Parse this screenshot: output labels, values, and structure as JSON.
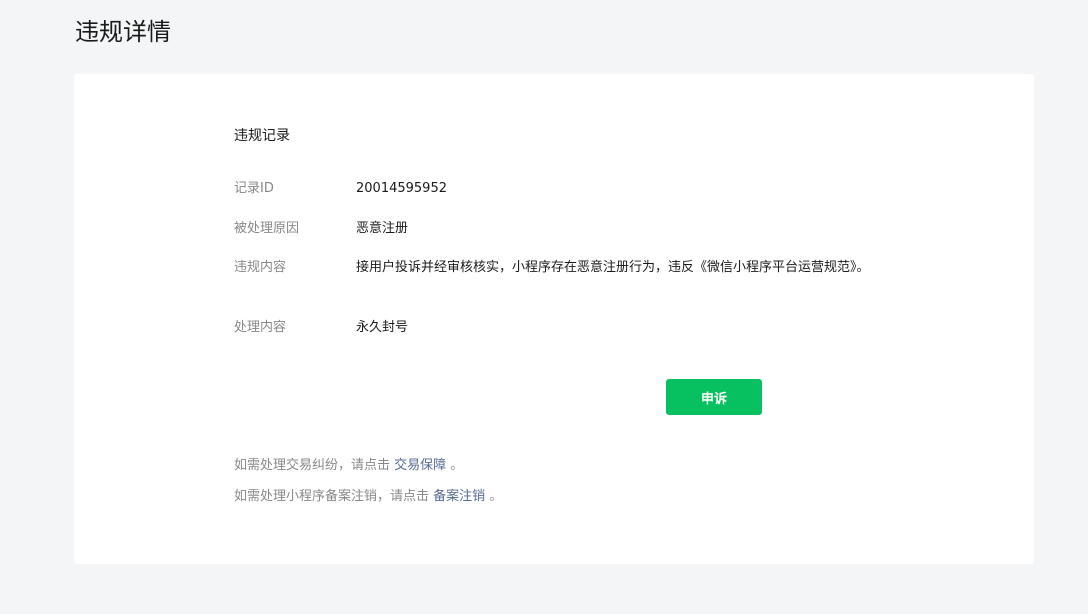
{
  "header": {
    "title": "违规详情"
  },
  "record": {
    "section_title": "违规记录",
    "rows": [
      {
        "label": "记录ID",
        "value": "20014595952"
      },
      {
        "label": "被处理原因",
        "value": "恶意注册"
      },
      {
        "label": "违规内容",
        "value": "接用户投诉并经审核核实，小程序存在恶意注册行为，违反《微信小程序平台运营规范》。"
      },
      {
        "label": "处理内容",
        "value": "永久封号"
      }
    ]
  },
  "actions": {
    "appeal_label": "申诉"
  },
  "notes": {
    "trade": {
      "prefix": "如需处理交易纠纷，请点击 ",
      "link": "交易保障",
      "suffix": " 。"
    },
    "filing": {
      "prefix": "如需处理小程序备案注销，请点击 ",
      "link": "备案注销",
      "suffix": " 。"
    }
  },
  "colors": {
    "primary_button": "#07c160",
    "link": "#576b95",
    "label": "#888888",
    "background": "#f4f5f7"
  }
}
